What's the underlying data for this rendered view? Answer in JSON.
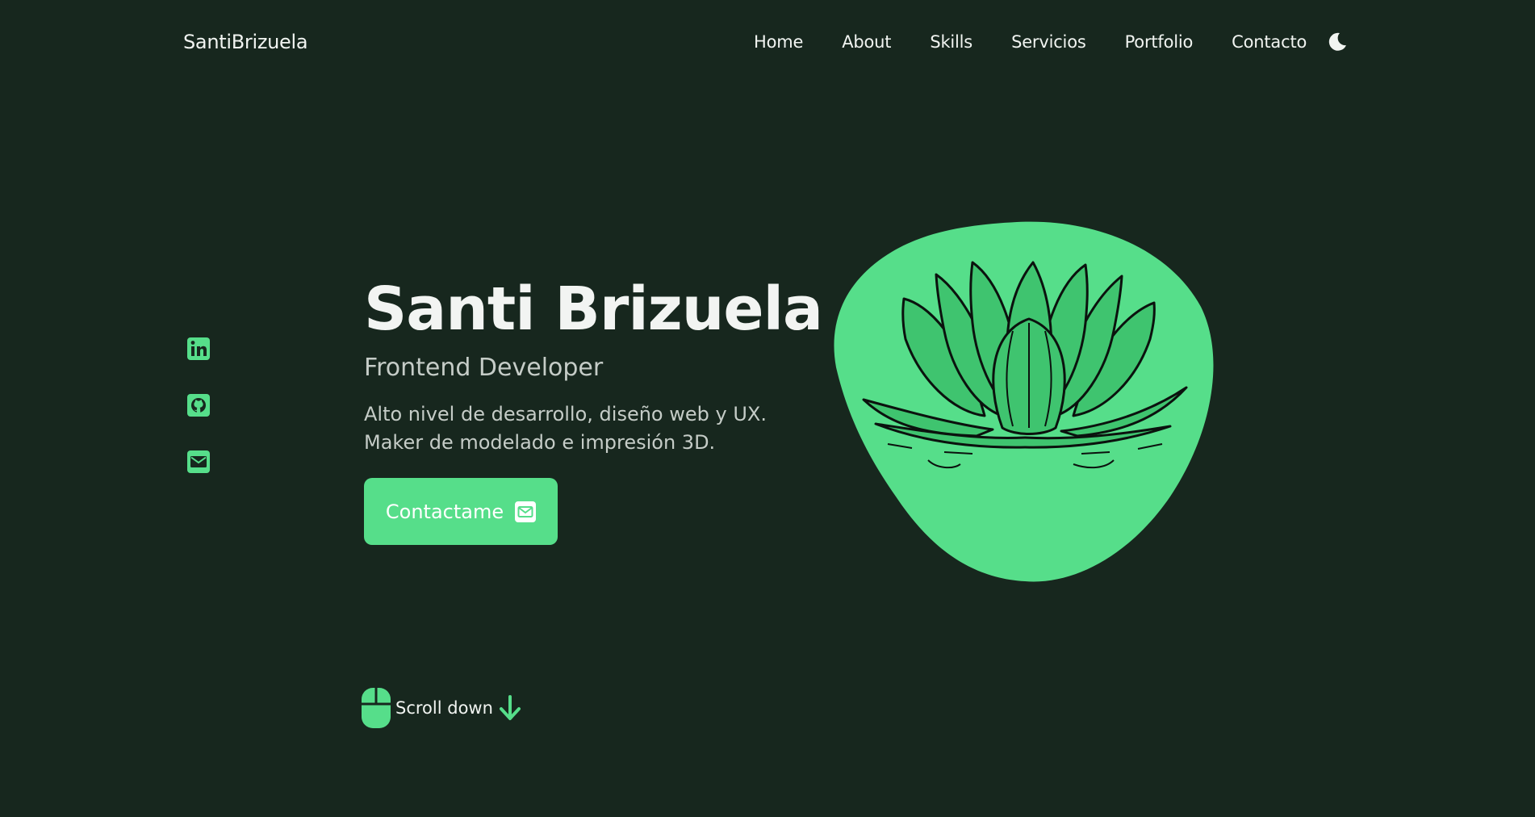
{
  "header": {
    "logo": "SantiBrizuela",
    "nav": [
      {
        "label": "Home"
      },
      {
        "label": "About"
      },
      {
        "label": "Skills"
      },
      {
        "label": "Servicios"
      },
      {
        "label": "Portfolio"
      },
      {
        "label": "Contacto"
      }
    ],
    "theme_icon": "moon-icon"
  },
  "socials": [
    {
      "icon": "linkedin-icon"
    },
    {
      "icon": "github-icon"
    },
    {
      "icon": "mail-icon"
    }
  ],
  "hero": {
    "title": "Santi Brizuela",
    "subtitle": "Frontend Developer",
    "description_lines": [
      "Alto nivel de desarrollo, diseño web y UX.",
      "Maker de modelado e impresión 3D."
    ],
    "cta_label": "Contactame",
    "cta_icon": "mail-icon",
    "image_icon": "lotus-illustration"
  },
  "scroll": {
    "label": "Scroll down",
    "mouse_icon": "mouse-icon",
    "arrow_icon": "arrow-down-icon"
  },
  "colors": {
    "background": "#17271e",
    "accent": "#56de8a",
    "text": "#f1f4f1",
    "muted_text": "#c5ccc7"
  }
}
